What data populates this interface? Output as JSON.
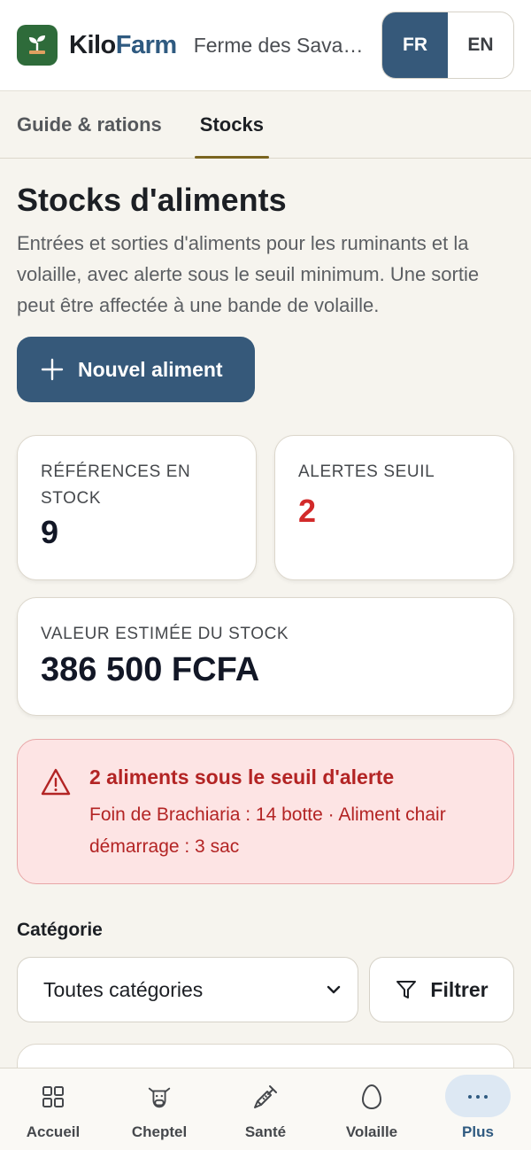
{
  "header": {
    "brand_part1": "Kilo",
    "brand_part2": "Farm",
    "farm_name": "Ferme des Savanes",
    "languages": [
      {
        "label": "FR",
        "active": true
      },
      {
        "label": "EN",
        "active": false
      }
    ]
  },
  "tabs": [
    {
      "label": "Guide & rations",
      "active": false
    },
    {
      "label": "Stocks",
      "active": true
    }
  ],
  "page": {
    "title": "Stocks d'aliments",
    "description": "Entrées et sorties d'aliments pour les ruminants et la volaille, avec alerte sous le seuil minimum. Une sortie peut être affectée à une bande de volaille.",
    "new_button": "Nouvel aliment"
  },
  "stats": {
    "references": {
      "label": "RÉFÉRENCES EN STOCK",
      "value": "9"
    },
    "alerts": {
      "label": "ALERTES SEUIL",
      "value": "2"
    },
    "stock_value": {
      "label": "VALEUR ESTIMÉE DU STOCK",
      "value": "386 500 FCFA"
    }
  },
  "alert_banner": {
    "title": "2 aliments sous le seuil d'alerte",
    "body": "Foin de Brachiaria : 14 botte · Aliment chair démarrage : 3 sac"
  },
  "filter": {
    "category_label": "Catégorie",
    "category_selected": "Toutes catégories",
    "filter_button": "Filtrer"
  },
  "bottom_nav": [
    {
      "label": "Accueil",
      "icon": "grid-icon",
      "active": false
    },
    {
      "label": "Cheptel",
      "icon": "cow-icon",
      "active": false
    },
    {
      "label": "Santé",
      "icon": "syringe-icon",
      "active": false
    },
    {
      "label": "Volaille",
      "icon": "egg-icon",
      "active": false
    },
    {
      "label": "Plus",
      "icon": "more-icon",
      "active": true
    }
  ],
  "colors": {
    "primary": "#36597a",
    "alert_text": "#b32424",
    "alert_bg": "#fde4e4",
    "alert_count": "#d22a2a",
    "logo_bg": "#2e6b3a"
  }
}
